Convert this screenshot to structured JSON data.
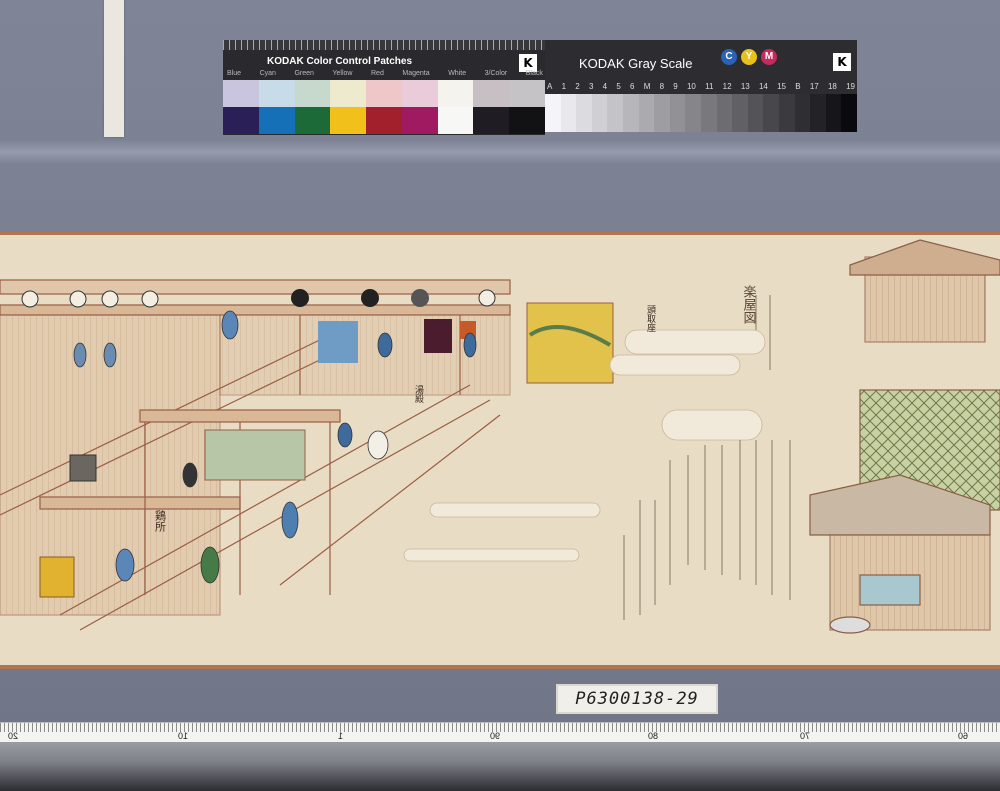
{
  "color_card": {
    "title": "KODAK Color Control Patches",
    "labels": [
      "Blue",
      "Cyan",
      "Green",
      "Yellow",
      "Red",
      "Magenta",
      "White",
      "3/Color",
      "Black"
    ],
    "top_row": [
      "#c9c5df",
      "#c7dce8",
      "#c6d9cc",
      "#eeeacd",
      "#f0c7c9",
      "#eacbd9",
      "#f4f3ee",
      "#c8bfc5",
      "#c6c3c7"
    ],
    "bottom_row": [
      "#2a2057",
      "#1670b8",
      "#1b6a37",
      "#f2c01a",
      "#a1202b",
      "#a01a62",
      "#f7f7f5",
      "#201c24",
      "#121214"
    ],
    "logo": "K"
  },
  "gray_card": {
    "title": "KODAK Gray Scale",
    "cym": [
      {
        "letter": "C",
        "color": "#2a62b8"
      },
      {
        "letter": "Y",
        "color": "#e8c21a"
      },
      {
        "letter": "M",
        "color": "#c42a5c"
      }
    ],
    "numbers": [
      "A",
      "1",
      "2",
      "3",
      "4",
      "5",
      "6",
      "M",
      "8",
      "9",
      "10",
      "11",
      "12",
      "13",
      "14",
      "15",
      "B",
      "17",
      "18",
      "19"
    ],
    "logo": "K"
  },
  "scroll": {
    "right_title": "楽屋図",
    "caption_block": "楽屋之図",
    "signs": [
      "鶏所",
      "湯殿",
      "頭取座"
    ]
  },
  "id_label": "P6300138-29",
  "ruler": {
    "numbers": [
      "20",
      "10",
      "1",
      "90",
      "80",
      "70",
      "60"
    ]
  }
}
